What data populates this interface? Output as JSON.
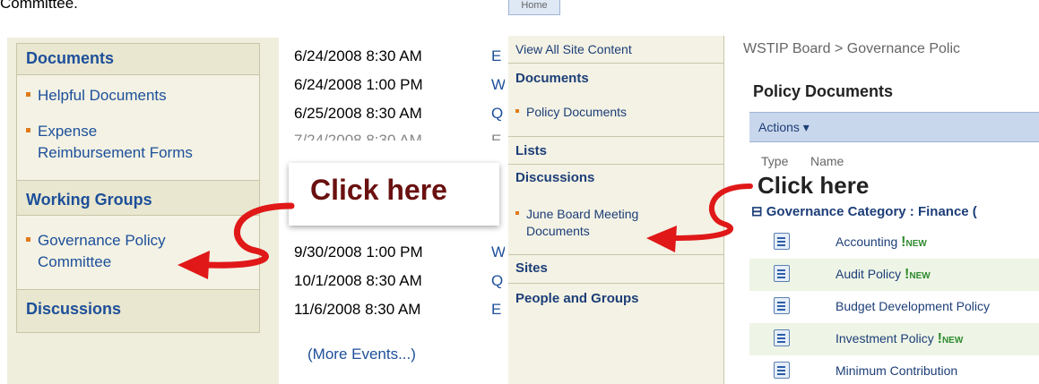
{
  "caption": "Committee.",
  "left_nav": {
    "documents_head": "Documents",
    "doc_items": [
      "Helpful Documents",
      "Expense",
      "Reimbursement Forms"
    ],
    "working_groups_head": "Working Groups",
    "wg_items": [
      "Governance Policy",
      "Committee"
    ],
    "discussions_head": "Discussions"
  },
  "events": {
    "rows": [
      {
        "date": "6/24/2008 8:30 AM",
        "title": "E"
      },
      {
        "date": "6/24/2008 1:00 PM",
        "title": "W"
      },
      {
        "date": "6/25/2008 8:30 AM",
        "title": "Q"
      },
      {
        "date": "7/24/2008 8:30 AM",
        "title": "E"
      },
      {
        "date": "9/30/2008 1:00 PM",
        "title": "W"
      },
      {
        "date": "10/1/2008 8:30 AM",
        "title": "Q"
      },
      {
        "date": "11/6/2008 8:30 AM",
        "title": "E"
      }
    ],
    "more": "(More Events...)"
  },
  "callout_left": "Click here",
  "right": {
    "tab": "Home",
    "nav": {
      "view_all": "View All Site Content",
      "documents_head": "Documents",
      "policy_docs": "Policy Documents",
      "lists_head": "Lists",
      "discussions_head": "Discussions",
      "june_board": [
        "June Board Meeting",
        "Documents"
      ],
      "sites_head": "Sites",
      "people_head": "People and Groups"
    },
    "breadcrumb": "WSTIP Board > Governance Polic",
    "title": "Policy Documents",
    "actions": "Actions ▾",
    "col_type": "Type",
    "col_name": "Name",
    "callout": "Click here",
    "group": "⊟ Governance Category : Finance (",
    "docs": [
      {
        "name": "Accounting",
        "new": true
      },
      {
        "name": "Audit Policy",
        "new": true
      },
      {
        "name": "Budget Development Policy",
        "new": false
      },
      {
        "name": "Investment Policy",
        "new": true
      },
      {
        "name": "Minimum Contribution",
        "new": false
      }
    ],
    "new_label": "NEW"
  },
  "colors": {
    "link": "#1d4f9a",
    "accent": "#e07b1b",
    "arrow": "#e01818",
    "new": "#2e8b2e"
  }
}
